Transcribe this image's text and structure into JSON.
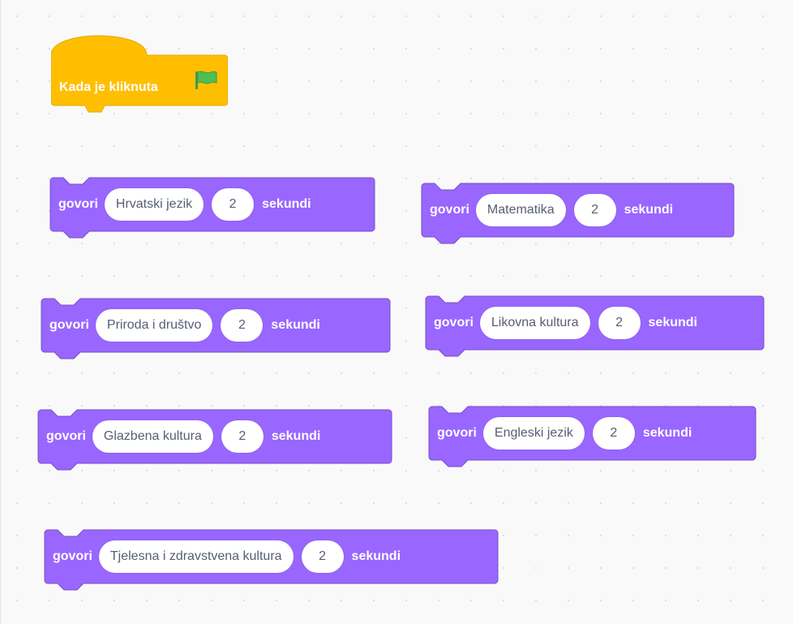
{
  "hat_block": {
    "label": "Kada je kliknuta",
    "icon": "green-flag-icon",
    "color": "#ffbf00",
    "border_color": "#e6a800"
  },
  "say_blocks": [
    {
      "keyword": "govori",
      "message": "Hrvatski jezik",
      "seconds": "2",
      "suffix": "sekundi"
    },
    {
      "keyword": "govori",
      "message": "Matematika",
      "seconds": "2",
      "suffix": "sekundi"
    },
    {
      "keyword": "govori",
      "message": "Priroda i društvo",
      "seconds": "2",
      "suffix": "sekundi"
    },
    {
      "keyword": "govori",
      "message": "Likovna kultura",
      "seconds": "2",
      "suffix": "sekundi"
    },
    {
      "keyword": "govori",
      "message": "Glazbena kultura",
      "seconds": "2",
      "suffix": "sekundi"
    },
    {
      "keyword": "govori",
      "message": "Engleski jezik",
      "seconds": "2",
      "suffix": "sekundi"
    },
    {
      "keyword": "govori",
      "message": "Tjelesna i zdravstvena kultura",
      "seconds": "2",
      "suffix": "sekundi"
    }
  ],
  "colors": {
    "looks_block": "#9966ff",
    "looks_block_border": "#774dcb",
    "workspace_bg": "#f9f9f9",
    "flag_green": "#4cbf56"
  }
}
